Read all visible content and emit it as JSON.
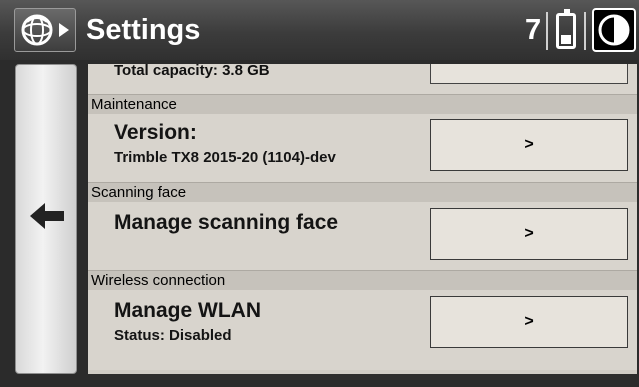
{
  "header": {
    "title": "Settings",
    "job_count": "7",
    "logo_icon": "trimble-logo-icon",
    "battery_icon": "battery-icon",
    "contrast_icon": "contrast-icon"
  },
  "nav": {
    "back_icon": "arrow-left-icon"
  },
  "storage": {
    "capacity_label": "Total capacity: 3.8 GB"
  },
  "sections": [
    {
      "header": "Maintenance",
      "title": "Version:",
      "subtitle": "Trimble TX8 2015-20 (1104)-dev",
      "button": ">"
    },
    {
      "header": "Scanning face",
      "title": "Manage scanning face",
      "button": ">"
    },
    {
      "header": "Wireless connection",
      "title": "Manage WLAN",
      "subtitle": "Status: Disabled",
      "button": ">"
    }
  ],
  "colors": {
    "titlebar": "#3c3c3c",
    "content_bg": "#d8d4cd",
    "section_header_bg": "#c6c2bb",
    "button_bg": "#e7e3dc"
  }
}
